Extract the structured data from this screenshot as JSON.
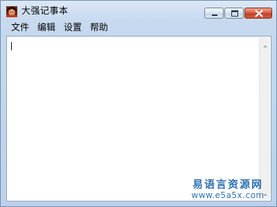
{
  "window": {
    "title": "大强记事本",
    "icon": "app-avatar-icon",
    "controls": {
      "minimize": "minimize-icon",
      "maximize": "maximize-icon",
      "close": "close-icon"
    }
  },
  "menu": {
    "items": [
      {
        "label": "文件"
      },
      {
        "label": "编辑"
      },
      {
        "label": "设置"
      },
      {
        "label": "帮助"
      }
    ]
  },
  "editor": {
    "content": ""
  },
  "watermark": {
    "line1": "易语言资源网",
    "line2": "www.e5a5x.com"
  },
  "colors": {
    "frame": "#c6d9ee",
    "close_button": "#c0412b",
    "watermark": "#2e70b3"
  }
}
